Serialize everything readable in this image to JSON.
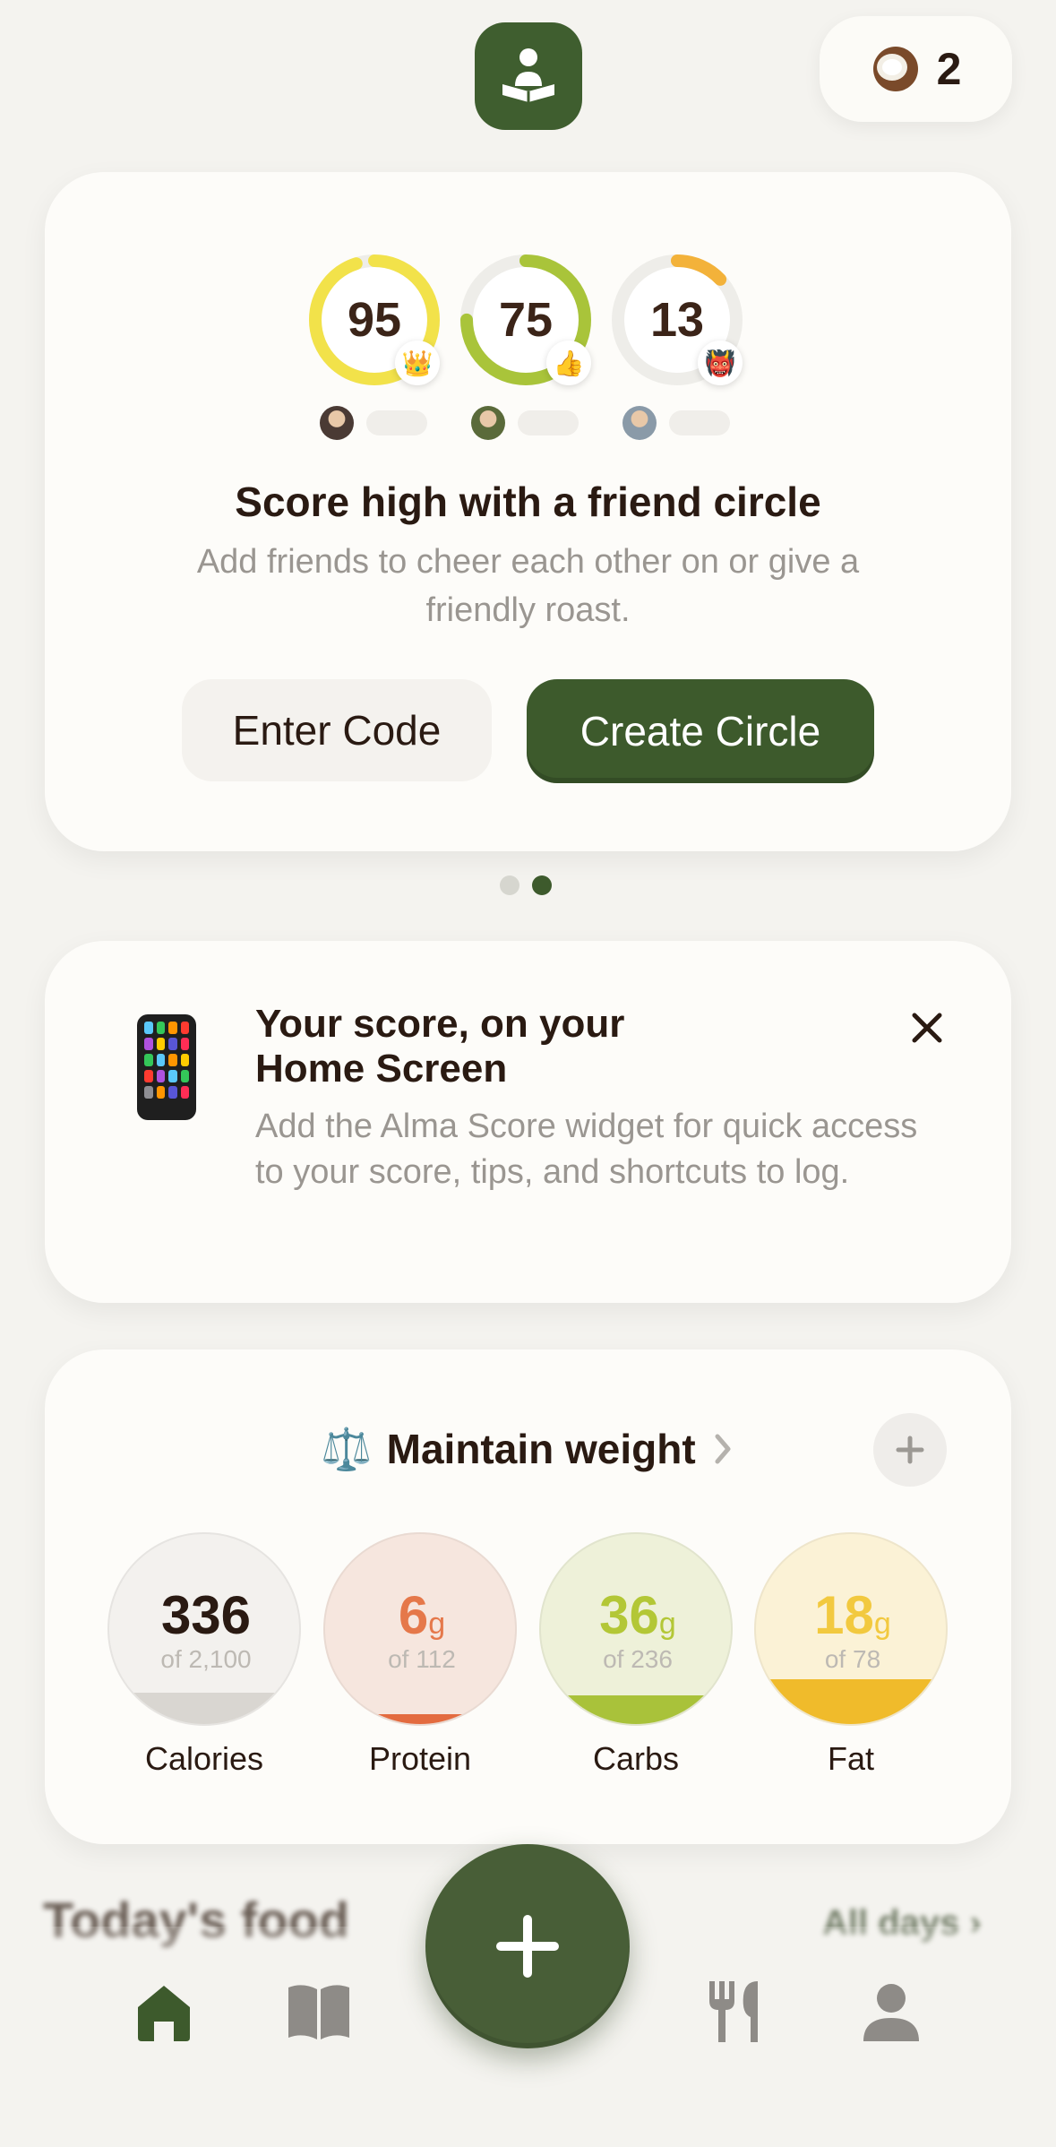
{
  "header": {
    "logo_icon": "reading-person-icon",
    "coconut_icon": "coconut-icon",
    "coconut_count": "2"
  },
  "friend_circle": {
    "scores": [
      {
        "value": "95",
        "progress": 0.95,
        "color": "#f2e24a",
        "badge": "👑"
      },
      {
        "value": "75",
        "progress": 0.75,
        "color": "#a9c43a",
        "badge": "👍"
      },
      {
        "value": "13",
        "progress": 0.13,
        "color": "#f3b23a",
        "badge": "👹"
      }
    ],
    "title": "Score high with a friend circle",
    "subtitle": "Add friends to cheer each other on or give a friendly roast.",
    "enter_code_label": "Enter Code",
    "create_circle_label": "Create Circle"
  },
  "pager": {
    "count": 2,
    "active": 2
  },
  "widget_card": {
    "icon": "phone-icon",
    "title": "Your score, on your Home Screen",
    "description": "Add the Alma Score widget for quick access to your score, tips, and shortcuts to log.",
    "close_icon": "close-icon"
  },
  "goal": {
    "icon": "⚖️",
    "label": "Maintain weight",
    "chevron_icon": "chevron-right-icon",
    "add_icon": "plus-icon"
  },
  "macros": [
    {
      "label": "Calories",
      "value": "336",
      "unit": "",
      "of": "of 2,100",
      "progress": 0.16,
      "color": "#2a1a12",
      "bg": "#f3f1ee",
      "fill": "#d9d6d1"
    },
    {
      "label": "Protein",
      "value": "6",
      "unit": "g",
      "of": "of 112",
      "progress": 0.05,
      "color": "#e5784a",
      "bg": "#f6e6de",
      "fill": "#e36b3f"
    },
    {
      "label": "Carbs",
      "value": "36",
      "unit": "g",
      "of": "of 236",
      "progress": 0.15,
      "color": "#b3c736",
      "bg": "#eef1d9",
      "fill": "#a9c23a"
    },
    {
      "label": "Fat",
      "value": "18",
      "unit": "g",
      "of": "of 78",
      "progress": 0.23,
      "color": "#f2c93f",
      "bg": "#fbf2d6",
      "fill": "#f0bb2b"
    }
  ],
  "footer": {
    "section_title": "Today's food",
    "all_days_label": "All days ›",
    "nav": {
      "home_icon": "home-icon",
      "book_icon": "book-icon",
      "add_icon": "plus-icon",
      "fork_knife_icon": "fork-knife-icon",
      "profile_icon": "profile-icon"
    }
  }
}
